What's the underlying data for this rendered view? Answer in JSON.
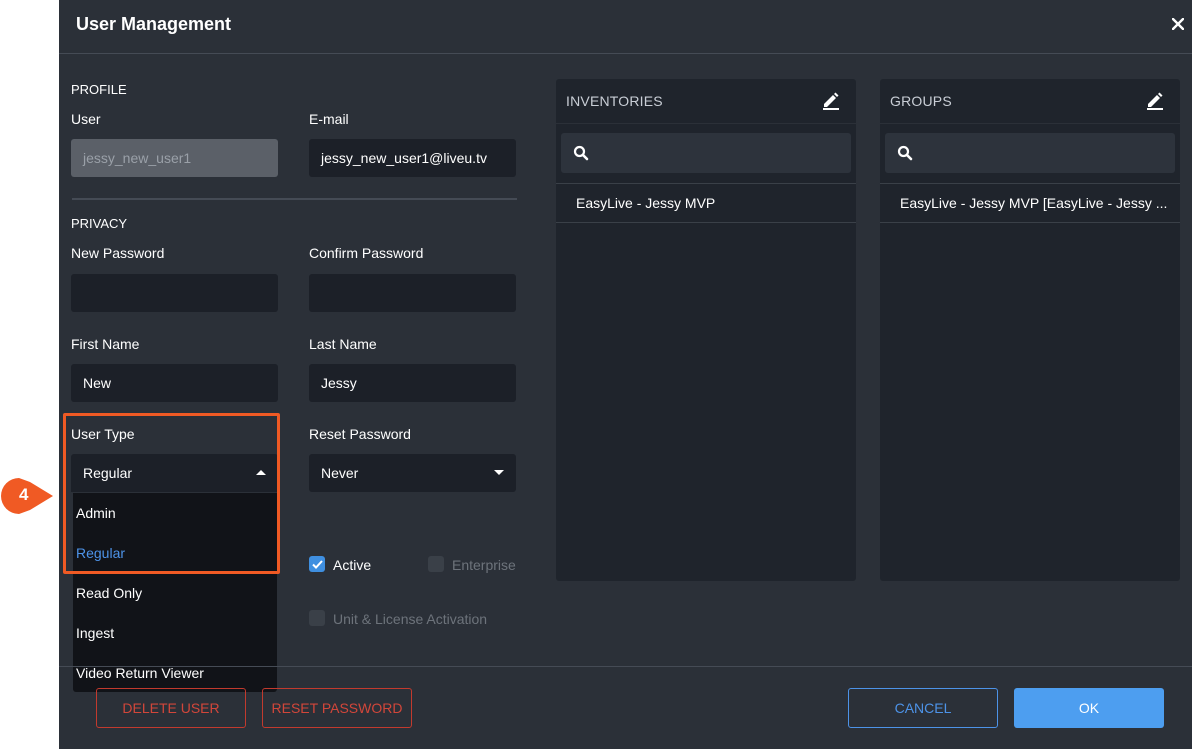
{
  "dialog": {
    "title": "User Management",
    "close_icon": "close-icon"
  },
  "profile": {
    "section_label": "PROFILE",
    "user_label": "User",
    "user_value": "jessy_new_user1",
    "email_label": "E-mail",
    "email_value": "jessy_new_user1@liveu.tv"
  },
  "privacy": {
    "section_label": "PRIVACY",
    "new_password_label": "New Password",
    "confirm_password_label": "Confirm Password",
    "first_name_label": "First Name",
    "first_name_value": "New",
    "last_name_label": "Last Name",
    "last_name_value": "Jessy",
    "user_type_label": "User Type",
    "user_type_value": "Regular",
    "reset_password_label": "Reset Password",
    "reset_password_value": "Never"
  },
  "user_type_options": [
    "Admin",
    "Regular",
    "Read Only",
    "Ingest",
    "Video Return Viewer"
  ],
  "user_type_selected": "Regular",
  "checkboxes": {
    "active_label": "Active",
    "active_checked": true,
    "enterprise_label": "Enterprise",
    "enterprise_checked": false,
    "unit_license_label": "Unit & License Activation",
    "unit_license_checked": false
  },
  "inventories": {
    "title": "INVENTORIES",
    "items": [
      "EasyLive - Jessy MVP"
    ]
  },
  "groups": {
    "title": "GROUPS",
    "items": [
      "EasyLive - Jessy MVP [EasyLive - Jessy ..."
    ]
  },
  "footer": {
    "delete_user": "DELETE USER",
    "reset_password": "RESET PASSWORD",
    "cancel": "CANCEL",
    "ok": "OK"
  },
  "annotation": {
    "step_number": "4",
    "color": "#f05a24"
  },
  "colors": {
    "accent": "#4d93e8",
    "danger": "#d2463a",
    "dialog_bg": "#2b3038"
  }
}
